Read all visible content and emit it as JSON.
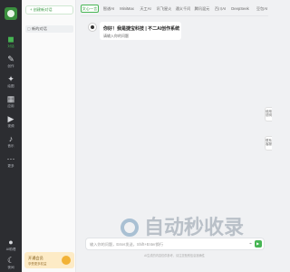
{
  "rail": {
    "items": [
      {
        "label": "对话",
        "icon": "chat-icon"
      },
      {
        "label": "创作",
        "icon": "pen-icon"
      },
      {
        "label": "绘图",
        "icon": "brush-icon"
      },
      {
        "label": "应用",
        "icon": "grid-icon"
      },
      {
        "label": "视频",
        "icon": "video-icon"
      },
      {
        "label": "音乐",
        "icon": "music-icon"
      },
      {
        "label": "更多",
        "icon": "more-icon"
      }
    ],
    "bottom": [
      {
        "label": "AI助理",
        "icon": "user-icon"
      },
      {
        "label": "夜间",
        "icon": "moon-icon"
      }
    ]
  },
  "panel": {
    "new_chat": "+ 创建新对话",
    "history_item": "新的对话",
    "promo_title": "开通会员",
    "promo_sub": "享受更多权益"
  },
  "tabs": [
    "文心一言",
    "智谱AI",
    "MiniMax",
    "天工AI",
    "讯飞星火",
    "通义千问",
    "腾讯混元",
    "百川AI",
    "DeepSeek",
    "豆包AI"
  ],
  "welcome": {
    "title": "你好！我是捷宝科技 | 不二AI创作系统",
    "subtitle": "请输入你的问题"
  },
  "side_buttons": [
    "使用说明",
    "联系客服"
  ],
  "input": {
    "placeholder": "输入你的问题，Enter发送，Shift+Enter换行"
  },
  "footer": "AI生成的内容仅供参考，请注意甄别信息准确性",
  "watermark": "自动秒收录"
}
